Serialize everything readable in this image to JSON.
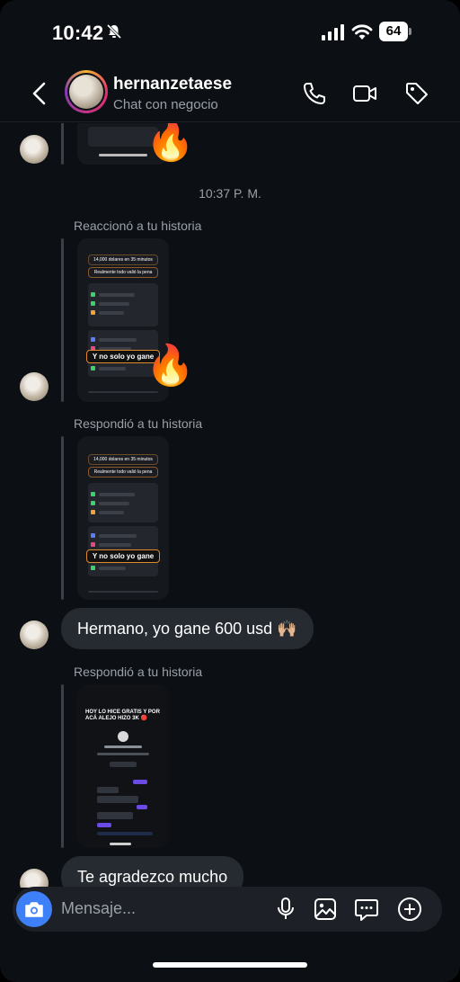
{
  "status_bar": {
    "time": "10:42",
    "battery": "64",
    "icons": [
      "bell-slash-icon",
      "cellular-signal-icon",
      "wifi-icon",
      "battery-icon"
    ]
  },
  "header": {
    "username": "hernanzetaese",
    "subtitle": "Chat con negocio",
    "icons": [
      "back-chevron-icon",
      "phone-icon",
      "video-camera-icon",
      "tag-icon"
    ]
  },
  "chat": {
    "timestamp": "10:37 P. M.",
    "messages": [
      {
        "type": "story_reaction",
        "note": "Reaccionó a tu historia",
        "reaction": "🔥",
        "story_caption": "14,000 dolares en 35 minutos",
        "story_caption2": "Realmente todo valió la pena",
        "story_sticker": "Y no solo yo gane"
      },
      {
        "type": "story_reply",
        "note": "Respondió a tu historia",
        "story_caption": "14,000 dolares en 35 minutos",
        "story_caption2": "Realmente todo valió la pena",
        "story_sticker": "Y no solo yo gane",
        "reply_text": "Hermano, yo gane 600 usd 🙌🏼"
      },
      {
        "type": "story_reply",
        "note": "Respondió a tu historia",
        "story_caption": "HOY LO HICE GRATIS Y POR ACÁ ALEJO HIZO 3K 🔴",
        "reply_text": "Te agradezco mucho"
      }
    ]
  },
  "composer": {
    "placeholder": "Mensaje...",
    "icons": [
      "camera-icon",
      "microphone-icon",
      "gallery-icon",
      "sticker-chat-icon",
      "plus-circle-icon"
    ]
  },
  "colors": {
    "background": "#0c0f14",
    "bubble": "#262a31",
    "camera_button": "#3d80f7",
    "secondary_text": "#9aa0a8"
  }
}
